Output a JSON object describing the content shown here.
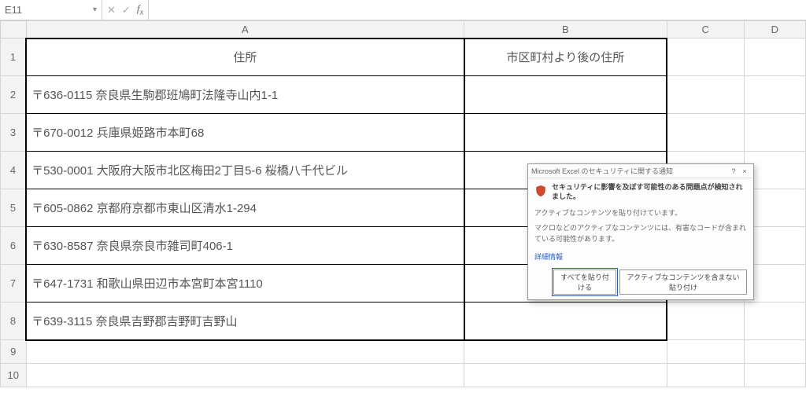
{
  "namebox": "E11",
  "formula": "",
  "columns": [
    "A",
    "B",
    "C",
    "D"
  ],
  "row_numbers": [
    1,
    2,
    3,
    4,
    5,
    6,
    7,
    8,
    9,
    10
  ],
  "headers": {
    "A": "住所",
    "B": "市区町村より後の住所"
  },
  "rows": [
    {
      "A": "〒636-0115 奈良県生駒郡班鳩町法隆寺山内1-1",
      "B": ""
    },
    {
      "A": "〒670-0012 兵庫県姫路市本町68",
      "B": ""
    },
    {
      "A": "〒530-0001 大阪府大阪市北区梅田2丁目5-6 桜橋八千代ビル",
      "B": ""
    },
    {
      "A": "〒605-0862 京都府京都市東山区清水1-294",
      "B": ""
    },
    {
      "A": "〒630-8587 奈良県奈良市雑司町406-1",
      "B": ""
    },
    {
      "A": "〒647-1731 和歌山県田辺市本宮町本宮1110",
      "B": ""
    },
    {
      "A": "〒639-3115 奈良県吉野郡吉野町吉野山",
      "B": ""
    }
  ],
  "dialog": {
    "title": "Microsoft Excel のセキュリティに関する通知",
    "heading": "セキュリティに影響を及ぼす可能性のある問題点が検知されました。",
    "line1": "アクティブなコンテンツを貼り付けています。",
    "line2": "マクロなどのアクティブなコンテンツには、有害なコードが含まれている可能性があります。",
    "details_link": "詳細情報",
    "btn_primary": "すべてを貼り付ける",
    "btn_secondary": "アクティブなコンテンツを含まない貼り付け",
    "help_icon": "?",
    "close_icon": "×"
  }
}
